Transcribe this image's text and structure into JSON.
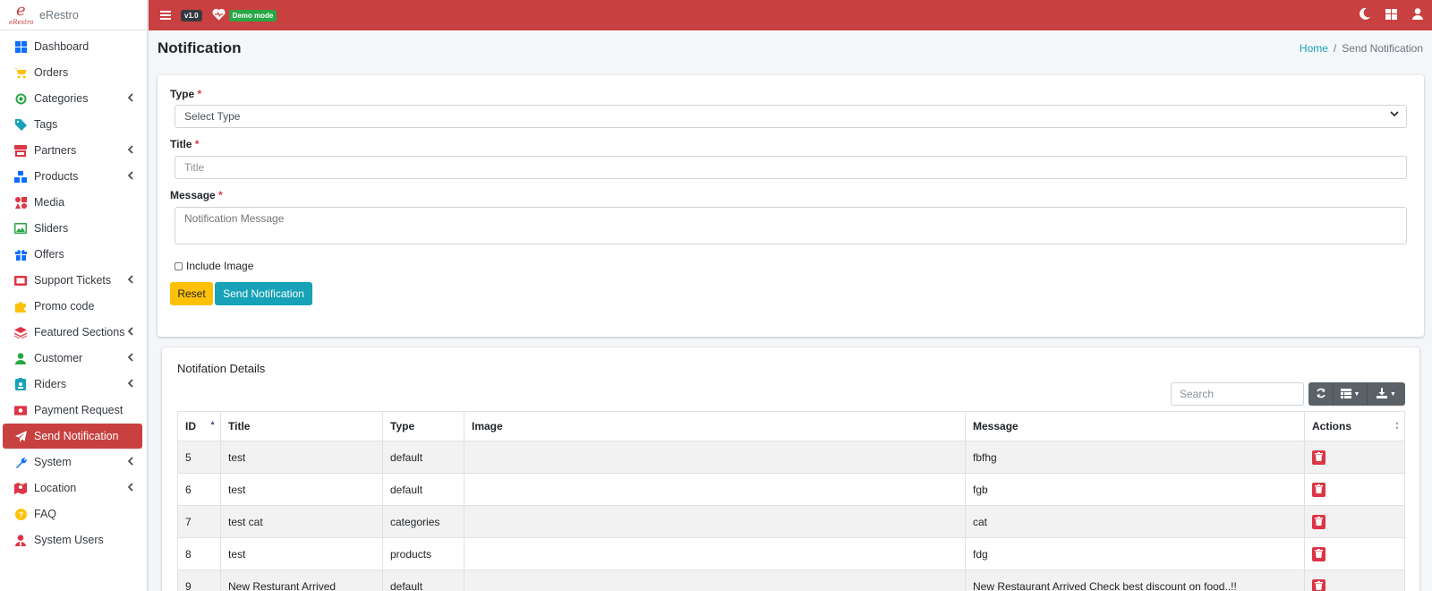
{
  "app": {
    "brand": "eRestro",
    "logo_mark": "e",
    "logo_word": "eRestro",
    "version": "v1.0",
    "mode_badge": "Demo mode"
  },
  "colors": {
    "primary": "#c94040",
    "info": "#17a2b8",
    "warning": "#ffc107",
    "success": "#28a745",
    "danger": "#dc3545"
  },
  "sidebar": {
    "items": [
      {
        "label": "Dashboard",
        "icon": "dashboard-icon",
        "color": "#0d6efd",
        "submenu": false
      },
      {
        "label": "Orders",
        "icon": "cart-icon",
        "color": "#ffc107",
        "submenu": false
      },
      {
        "label": "Categories",
        "icon": "bullseye-icon",
        "color": "#28a745",
        "submenu": true
      },
      {
        "label": "Tags",
        "icon": "tag-icon",
        "color": "#17a2b8",
        "submenu": false
      },
      {
        "label": "Partners",
        "icon": "store-icon",
        "color": "#dc3545",
        "submenu": true
      },
      {
        "label": "Products",
        "icon": "cubes-icon",
        "color": "#0d6efd",
        "submenu": true
      },
      {
        "label": "Media",
        "icon": "icons-icon",
        "color": "#dc3545",
        "submenu": false
      },
      {
        "label": "Sliders",
        "icon": "image-icon",
        "color": "#28a745",
        "submenu": false
      },
      {
        "label": "Offers",
        "icon": "gift-icon",
        "color": "#0d6efd",
        "submenu": false
      },
      {
        "label": "Support Tickets",
        "icon": "ticket-icon",
        "color": "#dc3545",
        "submenu": true
      },
      {
        "label": "Promo code",
        "icon": "puzzle-icon",
        "color": "#ffc107",
        "submenu": false
      },
      {
        "label": "Featured Sections",
        "icon": "layers-icon",
        "color": "#dc3545",
        "submenu": true
      },
      {
        "label": "Customer",
        "icon": "user-icon",
        "color": "#28a745",
        "submenu": true
      },
      {
        "label": "Riders",
        "icon": "id-badge-icon",
        "color": "#17a2b8",
        "submenu": true
      },
      {
        "label": "Payment Request",
        "icon": "money-icon",
        "color": "#dc3545",
        "submenu": false
      },
      {
        "label": "Send Notification",
        "icon": "paper-plane-icon",
        "color": "#ffffff",
        "submenu": false,
        "active": true
      },
      {
        "label": "System",
        "icon": "wrench-icon",
        "color": "#0d6efd",
        "submenu": true
      },
      {
        "label": "Location",
        "icon": "map-icon",
        "color": "#dc3545",
        "submenu": true
      },
      {
        "label": "FAQ",
        "icon": "question-icon",
        "color": "#ffc107",
        "submenu": false
      },
      {
        "label": "System Users",
        "icon": "user-tie-icon",
        "color": "#dc3545",
        "submenu": false
      }
    ]
  },
  "page": {
    "title": "Notification",
    "breadcrumb_home": "Home",
    "breadcrumb_sep": "/",
    "breadcrumb_current": "Send Notification"
  },
  "form": {
    "type_label": "Type",
    "type_value": "Select Type",
    "title_label": "Title",
    "title_placeholder": "Title",
    "message_label": "Message",
    "message_placeholder": "Notification Message",
    "required_mark": "*",
    "include_image_label": "Include Image",
    "reset_label": "Reset",
    "send_label": "Send Notification"
  },
  "table": {
    "title": "Notifation Details",
    "search_placeholder": "Search",
    "columns": [
      "ID",
      "Title",
      "Type",
      "Image",
      "Message",
      "Actions"
    ],
    "rows": [
      {
        "id": "5",
        "title": "test",
        "type": "default",
        "image": "",
        "message": "fbfhg"
      },
      {
        "id": "6",
        "title": "test",
        "type": "default",
        "image": "",
        "message": "fgb"
      },
      {
        "id": "7",
        "title": "test cat",
        "type": "categories",
        "image": "",
        "message": "cat"
      },
      {
        "id": "8",
        "title": "test",
        "type": "products",
        "image": "",
        "message": "fdg"
      },
      {
        "id": "9",
        "title": "New Resturant Arrived",
        "type": "default",
        "image": "",
        "message": "New Restaurant Arrived Check best discount on food..!!"
      }
    ]
  }
}
